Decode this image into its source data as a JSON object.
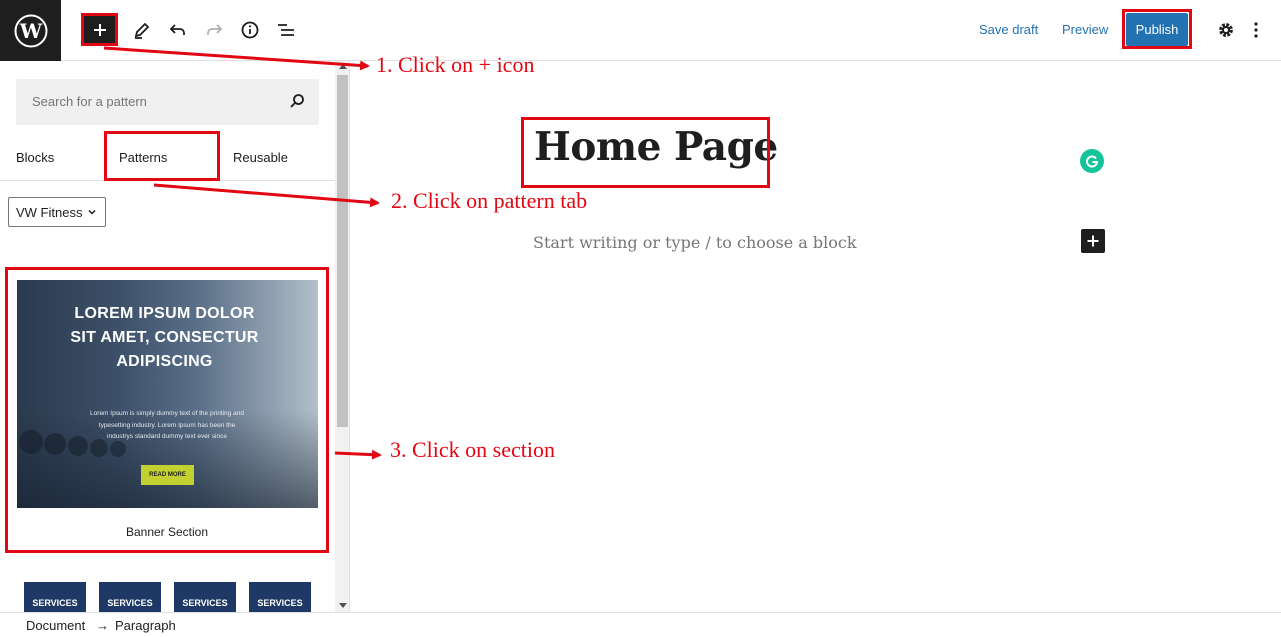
{
  "topbar": {
    "icons": [
      "wordpress-logo",
      "plus-icon",
      "pencil-icon",
      "undo-icon",
      "redo-icon",
      "info-icon",
      "list-view-icon",
      "gear-icon",
      "more-vertical-icon"
    ],
    "save_draft": "Save draft",
    "preview": "Preview",
    "publish": "Publish"
  },
  "inserter": {
    "search_placeholder": "Search for a pattern",
    "tabs": [
      "Blocks",
      "Patterns",
      "Reusable"
    ],
    "category": "VW Fitness",
    "patterns": [
      {
        "label": "Banner Section",
        "preview_title": "LOREM IPSUM DOLOR SIT AMET, CONSECTUR ADIPISCING",
        "preview_text": "Lorem Ipsum is simply dummy text of the printing and typesetting industry. Lorem Ipsum has been the industrys standard dummy text ever since",
        "preview_button": "READ MORE"
      },
      {
        "label": "",
        "preview_items": [
          "SERVICES",
          "SERVICES",
          "SERVICES",
          "SERVICES"
        ]
      }
    ]
  },
  "editor": {
    "title": "Home Page",
    "placeholder": "Start writing or type / to choose a block"
  },
  "annotations": [
    "1. Click on + icon",
    "2. Click on pattern tab",
    "3. Click on section"
  ],
  "annotation_color": "#e30613",
  "accent_color": "#2271b1",
  "footer": {
    "breadcrumb": [
      "Document",
      "Paragraph"
    ],
    "separator": "→"
  }
}
